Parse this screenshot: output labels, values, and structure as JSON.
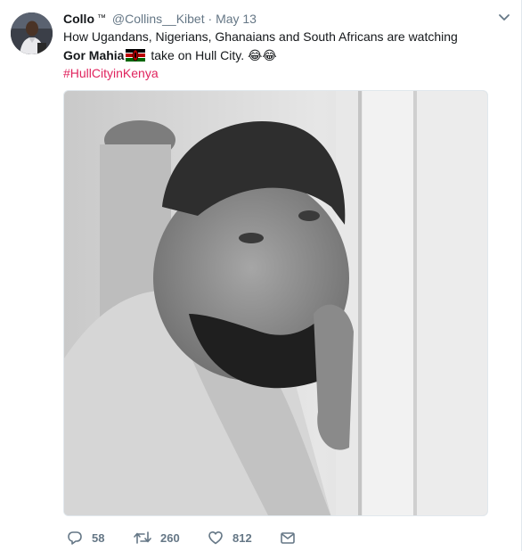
{
  "tweet": {
    "author_name": "Collo",
    "author_badge": "™",
    "handle": "@Collins__Kibet",
    "separator": "·",
    "date": "May 13",
    "text_part1": "How Ugandans, Nigerians, Ghanaians and South Africans are watching ",
    "text_bold": "Gor Mahia",
    "text_part2": " take on Hull City. ",
    "text_emoji": "😂😂",
    "flag_icon": "kenya-flag-icon",
    "hashtag": "#HullCityinKenya",
    "media_description_icon": "photo"
  },
  "actions": {
    "reply_count": "58",
    "retweet_count": "260",
    "like_count": "812"
  },
  "colors": {
    "text": "#14171a",
    "secondary": "#657786",
    "hashtag": "#e0245e",
    "border": "#e1e8ed"
  }
}
